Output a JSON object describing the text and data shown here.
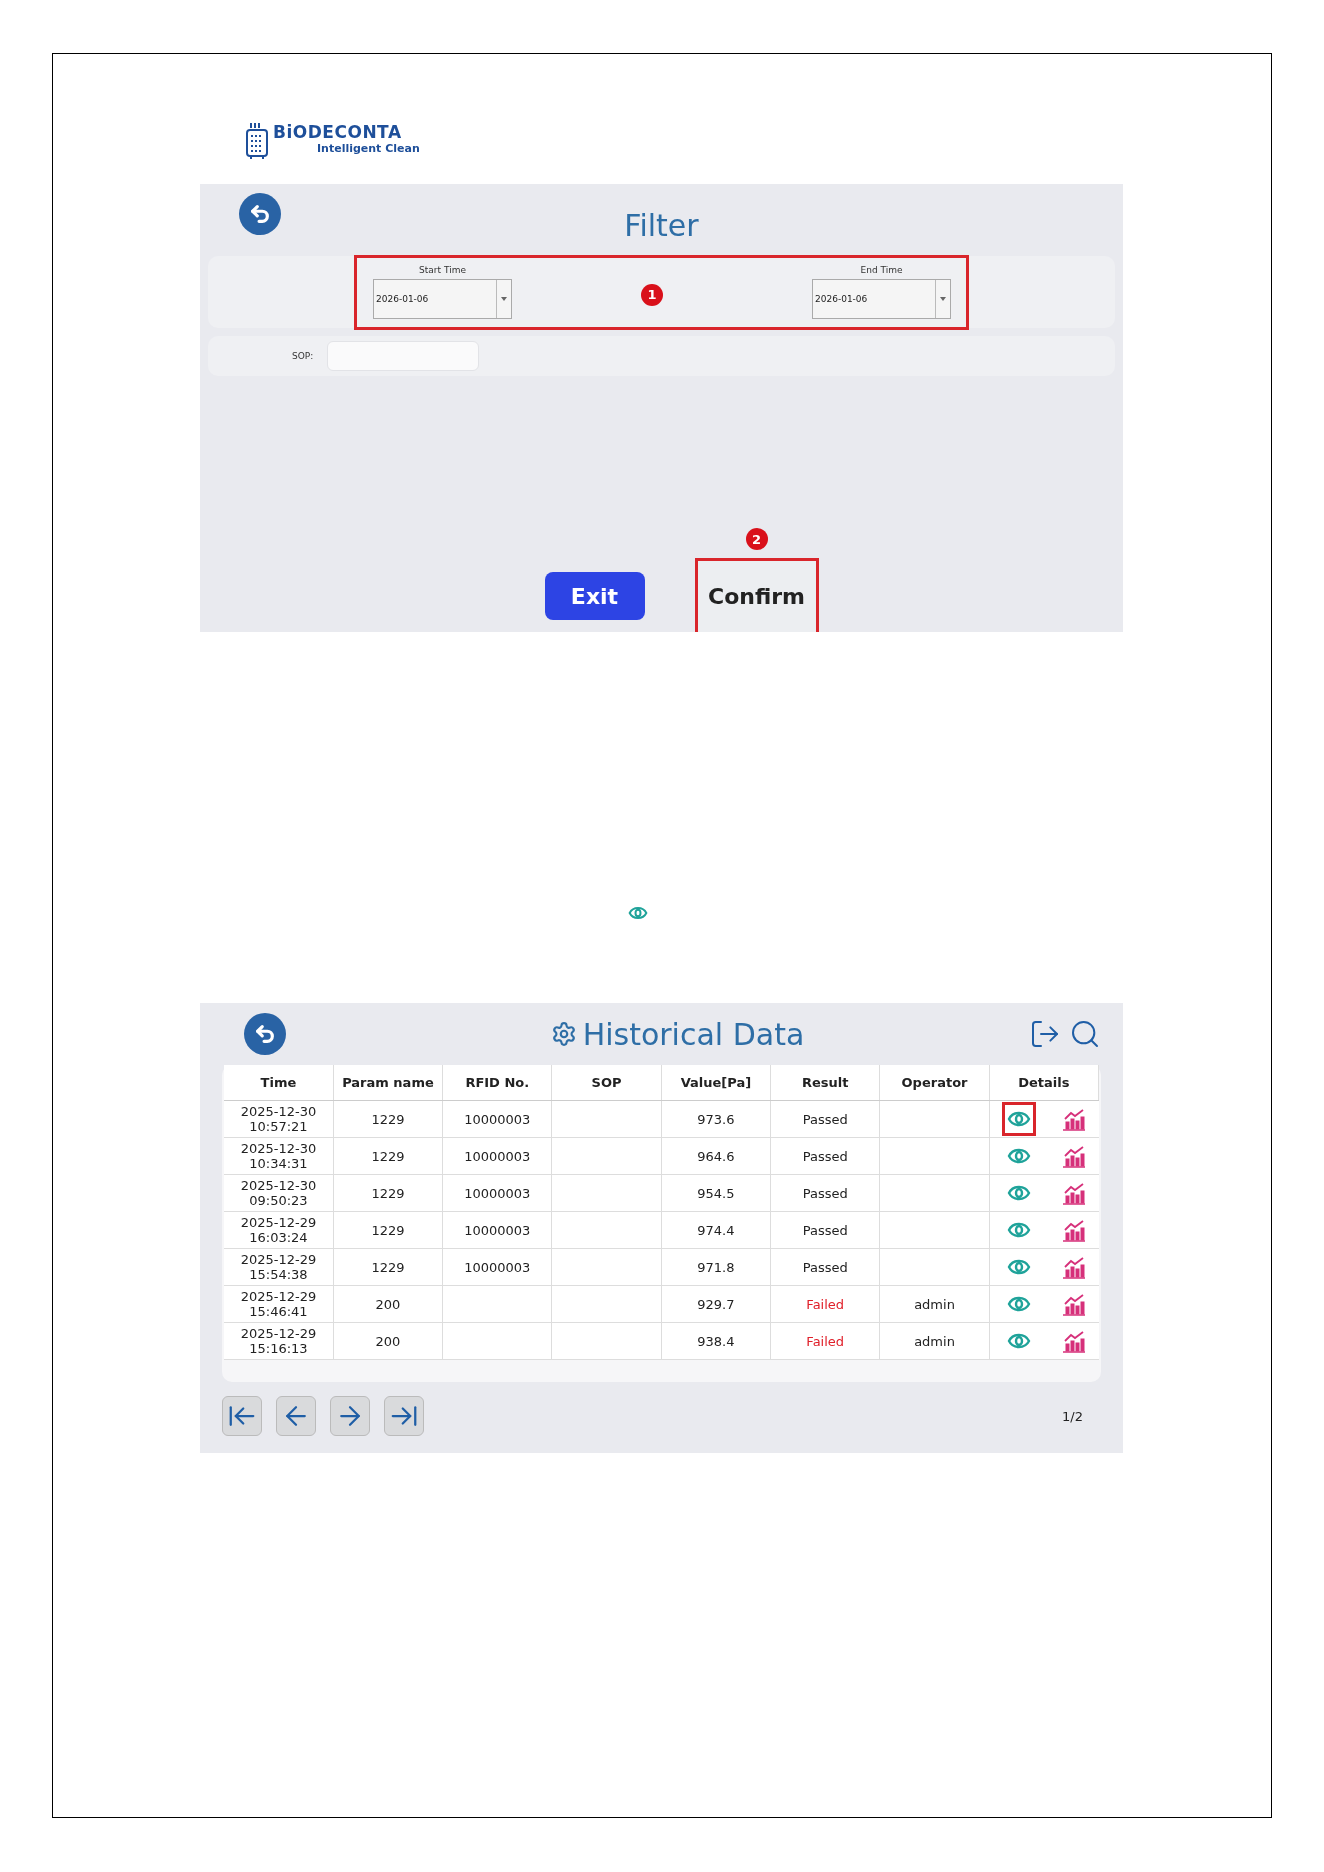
{
  "logo": {
    "brand": "BiODECONTA",
    "tagline": "Intelligent Clean"
  },
  "filter_screen": {
    "title": "Filter",
    "start_time": {
      "label": "Start Time",
      "value": "2026-01-06"
    },
    "end_time": {
      "label": "End Time",
      "value": "2026-01-06"
    },
    "sop": {
      "label": "SOP:"
    },
    "buttons": [
      {
        "label": "Exit",
        "kind": "primary",
        "highlighted": false
      },
      {
        "label": "Confirm",
        "kind": "plain",
        "highlighted": true
      }
    ],
    "annotations": [
      "1",
      "2"
    ]
  },
  "historical_screen": {
    "title": "Historical Data",
    "columns": [
      "Time",
      "Param name",
      "RFID No.",
      "SOP",
      "Value[Pa]",
      "Result",
      "Operator",
      "Details"
    ],
    "rows": [
      {
        "time": [
          "2025-12-30",
          "10:57:21"
        ],
        "param": "1229",
        "rfid": "10000003",
        "value": "973.6",
        "result": "Passed",
        "failed": false,
        "highlighted": true
      },
      {
        "time": [
          "2025-12-30",
          "10:34:31"
        ],
        "param": "1229",
        "rfid": "10000003",
        "value": "964.6",
        "result": "Passed",
        "failed": false,
        "highlighted": false
      },
      {
        "time": [
          "2025-12-30",
          "09:50:23"
        ],
        "param": "1229",
        "rfid": "10000003",
        "value": "954.5",
        "result": "Passed",
        "failed": false,
        "highlighted": false
      },
      {
        "time": [
          "2025-12-29",
          "16:03:24"
        ],
        "param": "1229",
        "rfid": "10000003",
        "value": "974.4",
        "result": "Passed",
        "failed": false,
        "highlighted": false
      },
      {
        "time": [
          "2025-12-29",
          "15:54:38"
        ],
        "param": "1229",
        "rfid": "10000003",
        "value": "971.8",
        "result": "Passed",
        "failed": false,
        "highlighted": false
      },
      {
        "time": [
          "2025-12-29",
          "15:46:41"
        ],
        "param": "200",
        "value": "929.7",
        "result": "Failed",
        "failed": true,
        "operator": "admin",
        "highlighted": false
      },
      {
        "time": [
          "2025-12-29",
          "15:16:13"
        ],
        "param": "200",
        "value": "938.4",
        "result": "Failed",
        "failed": true,
        "operator": "admin",
        "highlighted": false
      }
    ],
    "page": "1/2"
  }
}
